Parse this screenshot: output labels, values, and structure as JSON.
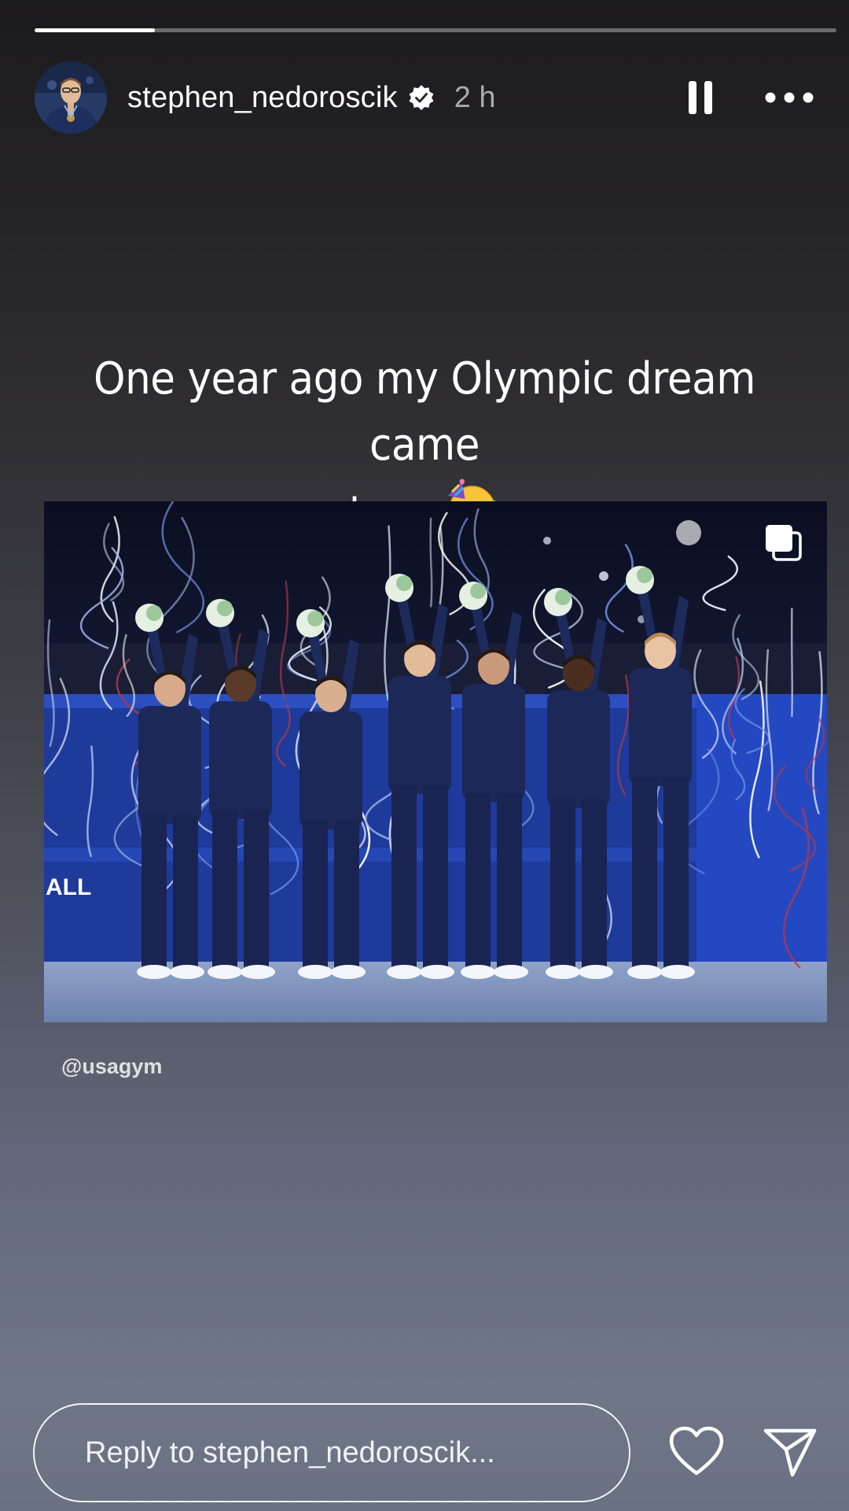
{
  "story": {
    "progress": 0.15
  },
  "header": {
    "username": "stephen_nedoroscik",
    "verified": true,
    "timestamp": "2 h",
    "avatar": "avatar",
    "pause_icon": "pause-icon",
    "more_icon": "more-horizontal-icon"
  },
  "caption": {
    "text": "One year ago my Olympic dream came true",
    "emoji": "🥳",
    "emoji_icon": "partying-face-emoji"
  },
  "photo": {
    "alt": "",
    "badge_icon": "multiple-images-icon"
  },
  "credit": {
    "text": "@usagym"
  },
  "reply": {
    "placeholder": "Reply to stephen_nedoroscik..."
  },
  "actions": {
    "like_icon": "heart-icon",
    "send_icon": "send-icon"
  },
  "colors": {
    "background_top": "#1b1a1c",
    "background_bottom": "#6a7182",
    "text": "#ffffff"
  }
}
